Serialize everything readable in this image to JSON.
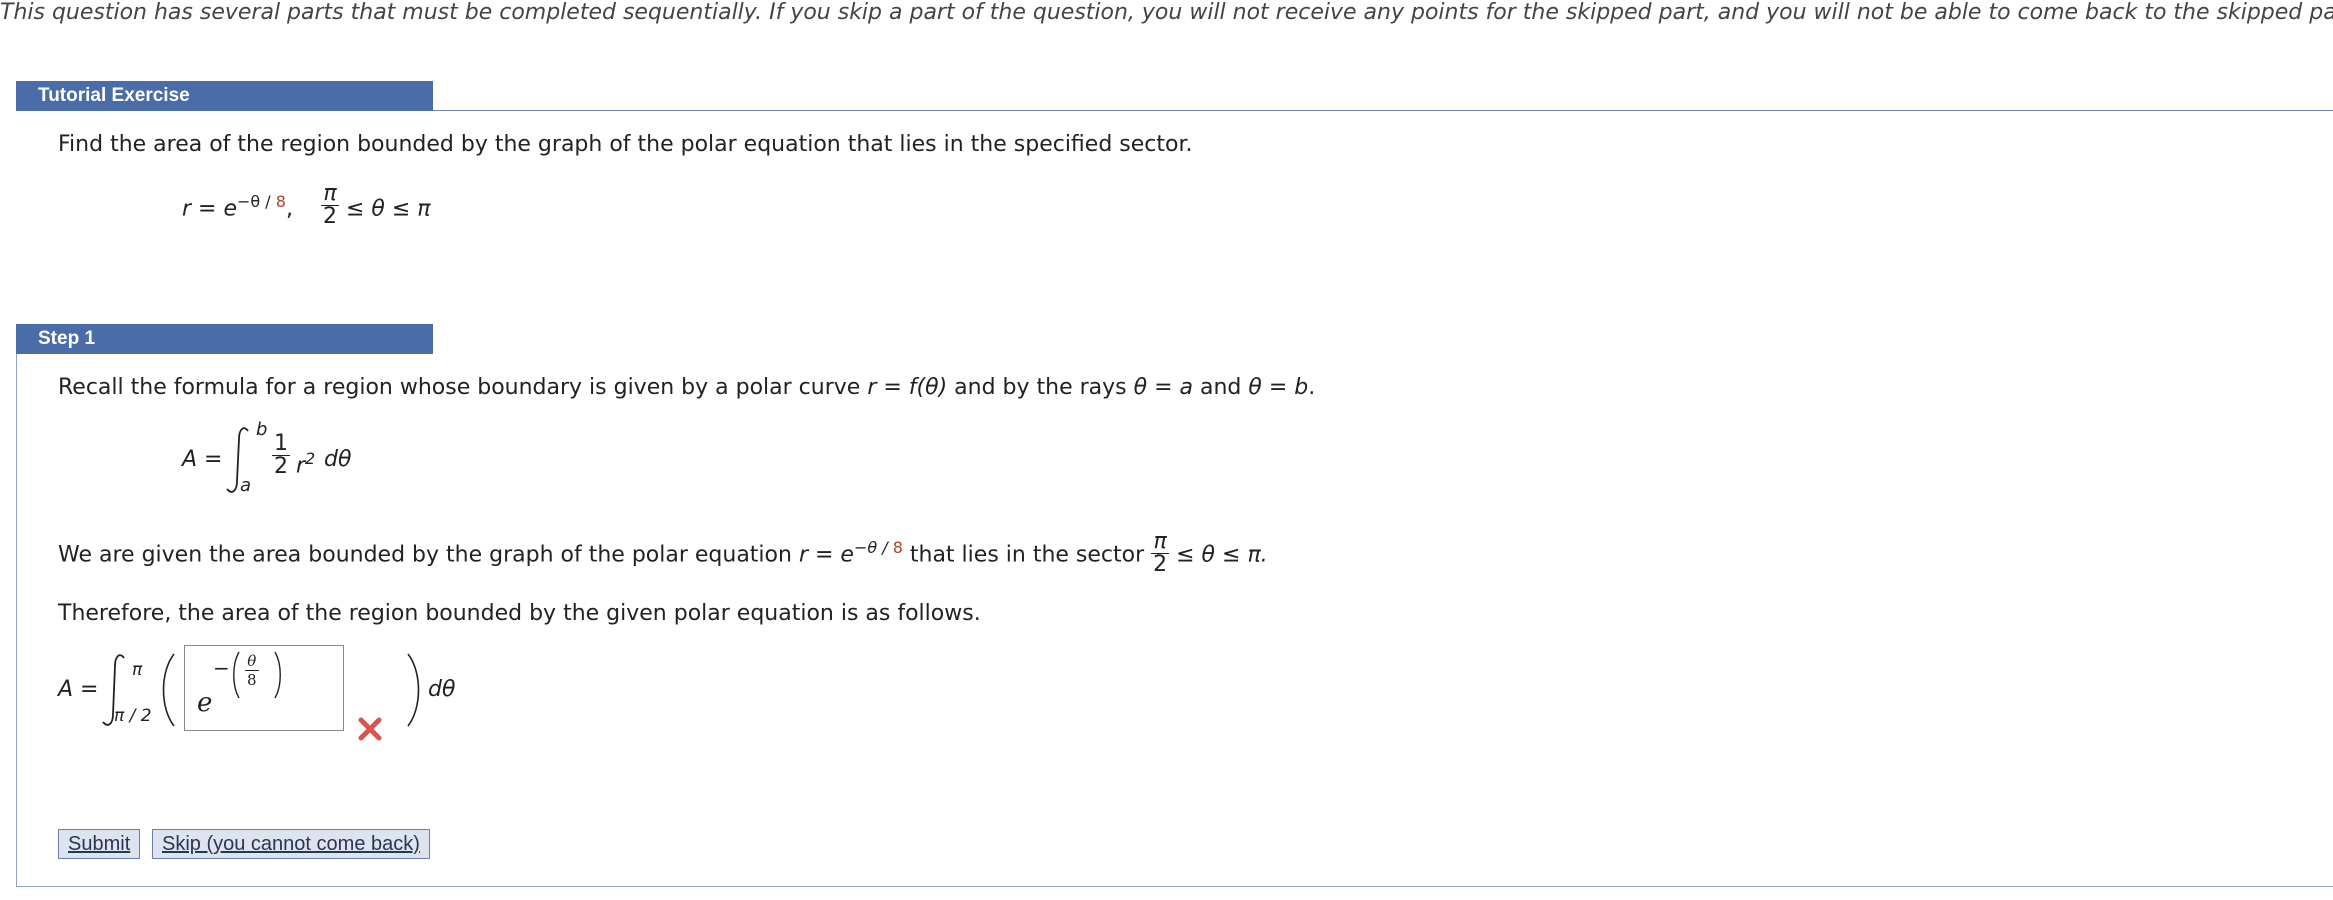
{
  "notice": "This question has several parts that must be completed sequentially. If you skip a part of the question, you will not receive any points for the skipped part, and you will not be able to come back to the skipped part.",
  "tutorial": {
    "header": "Tutorial Exercise",
    "prompt": "Find the area of the region bounded by the graph of the polar equation that lies in the specified sector.",
    "equation": {
      "lhs": "r = e",
      "exponent_prefix": "−θ / ",
      "exponent_value": "8",
      "comma": ",",
      "frac_num": "π",
      "frac_den": "2",
      "range_tail": "≤ θ ≤ π"
    }
  },
  "step1": {
    "header": "Step 1",
    "recall_pre": "Recall the formula for a region whose boundary is given by a polar curve ",
    "recall_curve": "r = f(θ)",
    "recall_mid": " and by the rays ",
    "recall_ray_a": "θ = a",
    "recall_and": " and ",
    "recall_ray_b": "θ = b",
    "recall_end": ".",
    "formula": {
      "lhs": "A =",
      "upper": "b",
      "lower": "a",
      "half_num": "1",
      "half_den": "2",
      "integrand": "r",
      "power": "2",
      "dtheta": "dθ"
    },
    "given_pre": "We are given the area bounded by the graph of the polar equation ",
    "given_eq": "r = e",
    "given_exp_prefix": "−θ / ",
    "given_exp_value": "8",
    "given_mid": " that lies in the sector ",
    "given_frac_num": "π",
    "given_frac_den": "2",
    "given_tail": " ≤ θ ≤ π.",
    "therefore": "Therefore, the area of the region bounded by the given polar equation is as follows.",
    "answer": {
      "lhs": "A =",
      "upper": "π",
      "lower": "π / 2",
      "input_base": "e",
      "input_minus": "−",
      "input_num": "θ",
      "input_den": "8",
      "dtheta": "dθ",
      "status": "incorrect"
    }
  },
  "buttons": {
    "submit": "Submit",
    "skip": "Skip (you cannot come back)"
  },
  "colors": {
    "header_bg": "#4a6ca8",
    "exponent_red": "#b0432c",
    "wrong_mark": "#d9534f"
  }
}
